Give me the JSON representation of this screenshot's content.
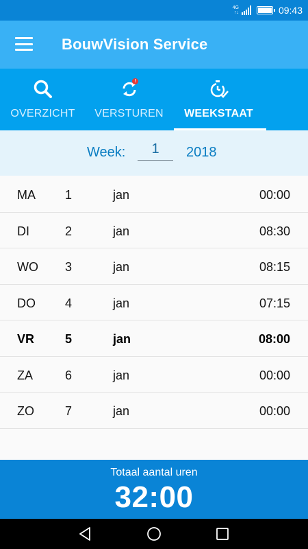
{
  "status_bar": {
    "network": "4G",
    "network_sub": "↑↓",
    "time": "09:43",
    "icons": [
      "signal-icon",
      "battery-icon"
    ]
  },
  "app_bar": {
    "title": "BouwVision Service",
    "menu_icon": "hamburger-menu-icon"
  },
  "tabs": [
    {
      "label": "OVERZICHT",
      "icon": "search-icon",
      "active": false
    },
    {
      "label": "VERSTUREN",
      "icon": "sync-icon",
      "active": false,
      "badge": "!"
    },
    {
      "label": "WEEKSTAAT",
      "icon": "timer-check-icon",
      "active": true
    }
  ],
  "week_selector": {
    "label": "Week:",
    "week_value": "1",
    "year": "2018"
  },
  "days": [
    {
      "day": "MA",
      "num": "1",
      "month": "jan",
      "hours": "00:00",
      "today": false
    },
    {
      "day": "DI",
      "num": "2",
      "month": "jan",
      "hours": "08:30",
      "today": false
    },
    {
      "day": "WO",
      "num": "3",
      "month": "jan",
      "hours": "08:15",
      "today": false
    },
    {
      "day": "DO",
      "num": "4",
      "month": "jan",
      "hours": "07:15",
      "today": false
    },
    {
      "day": "VR",
      "num": "5",
      "month": "jan",
      "hours": "08:00",
      "today": true
    },
    {
      "day": "ZA",
      "num": "6",
      "month": "jan",
      "hours": "00:00",
      "today": false
    },
    {
      "day": "ZO",
      "num": "7",
      "month": "jan",
      "hours": "00:00",
      "today": false
    }
  ],
  "total": {
    "label": "Totaal aantal uren",
    "value": "32:00"
  },
  "nav_bar": {
    "buttons": [
      "back-icon",
      "home-icon",
      "recents-icon"
    ]
  },
  "colors": {
    "status_bar": "#0a84d6",
    "app_bar": "#39b1f5",
    "tab_bar": "#03a1ee",
    "week_row": "#e4f3fb",
    "accent_text": "#0a7dc2",
    "total_bar": "#0a84d6",
    "badge": "#e53935"
  }
}
